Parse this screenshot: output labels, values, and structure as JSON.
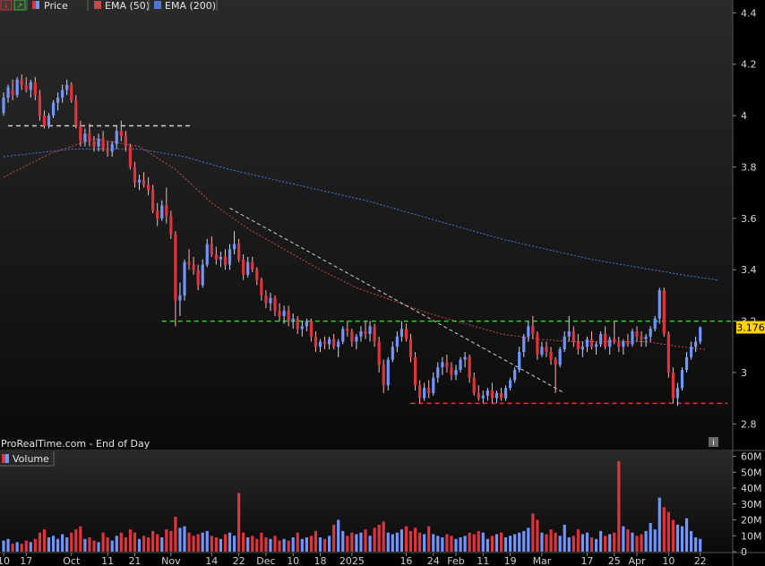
{
  "header": {
    "price_label": "Price",
    "ema50_label": "EMA (50)",
    "ema200_label": "EMA (200)"
  },
  "footer_text": "ProRealTime.com - End of Day",
  "volume_label": "Volume",
  "last_price_label": "3.176",
  "colors": {
    "up": "#6f95ff",
    "down": "#e0333a",
    "ema50": "#c84848",
    "ema200": "#4f76d6",
    "support": "#ff2a2a",
    "resistance": "#2ecc2e",
    "trend": "#cfcfcf",
    "price_tag": "#ffd400"
  },
  "chart_data": {
    "type": "candlestick",
    "price_axis": {
      "range": [
        2.7,
        4.45
      ],
      "ticks": [
        4.4,
        4.2,
        4,
        3.8,
        3.6,
        3.4,
        3.2,
        3,
        2.8
      ],
      "tick_labels": [
        "4.4",
        "4.2",
        "4",
        "3.8",
        "3.6",
        "3.4",
        "3.2",
        "3",
        "2.8"
      ]
    },
    "volume_axis": {
      "unit": "M",
      "range": [
        0,
        62
      ],
      "ticks": [
        60,
        50,
        40,
        30,
        20,
        10,
        0
      ],
      "tick_labels": [
        "60M",
        "50M",
        "40M",
        "30M",
        "20M",
        "10M",
        "0"
      ]
    },
    "x_labels": [
      {
        "label": "10",
        "i": 0
      },
      {
        "label": "17",
        "i": 5
      },
      {
        "label": "Oct",
        "i": 15
      },
      {
        "label": "11",
        "i": 23
      },
      {
        "label": "21",
        "i": 29
      },
      {
        "label": "Nov",
        "i": 37
      },
      {
        "label": "14",
        "i": 46
      },
      {
        "label": "22",
        "i": 52
      },
      {
        "label": "Dec",
        "i": 58
      },
      {
        "label": "10",
        "i": 64
      },
      {
        "label": "18",
        "i": 70
      },
      {
        "label": "2025",
        "i": 77
      },
      {
        "label": "16",
        "i": 89
      },
      {
        "label": "24",
        "i": 95
      },
      {
        "label": "Feb",
        "i": 100
      },
      {
        "label": "11",
        "i": 106
      },
      {
        "label": "19",
        "i": 112
      },
      {
        "label": "Mar",
        "i": 119
      },
      {
        "label": "17",
        "i": 129
      },
      {
        "label": "25",
        "i": 135
      },
      {
        "label": "Apr",
        "i": 140
      },
      {
        "label": "10",
        "i": 147
      },
      {
        "label": "22",
        "i": 154
      }
    ],
    "candles_ohlc_note": "open,high,low,close,volume(M)",
    "candles": [
      [
        4.01,
        4.09,
        4.0,
        4.07,
        7
      ],
      [
        4.07,
        4.12,
        4.05,
        4.11,
        8
      ],
      [
        4.1,
        4.14,
        4.06,
        4.08,
        5
      ],
      [
        4.08,
        4.15,
        4.07,
        4.14,
        6
      ],
      [
        4.14,
        4.16,
        4.1,
        4.12,
        5
      ],
      [
        4.12,
        4.15,
        4.09,
        4.1,
        7
      ],
      [
        4.1,
        4.14,
        4.07,
        4.13,
        6
      ],
      [
        4.13,
        4.15,
        4.06,
        4.08,
        8
      ],
      [
        4.08,
        4.1,
        3.98,
        4.0,
        12
      ],
      [
        4.0,
        4.02,
        3.95,
        3.96,
        14
      ],
      [
        3.96,
        4.01,
        3.95,
        4.0,
        9
      ],
      [
        4.0,
        4.06,
        3.99,
        4.05,
        10
      ],
      [
        4.05,
        4.09,
        4.02,
        4.07,
        8
      ],
      [
        4.07,
        4.12,
        4.05,
        4.1,
        11
      ],
      [
        4.1,
        4.14,
        4.08,
        4.12,
        9
      ],
      [
        4.12,
        4.13,
        4.05,
        4.06,
        12
      ],
      [
        4.06,
        4.08,
        3.95,
        3.96,
        14
      ],
      [
        3.96,
        3.98,
        3.88,
        3.9,
        16
      ],
      [
        3.9,
        3.95,
        3.88,
        3.93,
        8
      ],
      [
        3.93,
        3.97,
        3.88,
        3.9,
        9
      ],
      [
        3.9,
        3.92,
        3.86,
        3.88,
        7
      ],
      [
        3.88,
        3.93,
        3.86,
        3.91,
        6
      ],
      [
        3.91,
        3.94,
        3.86,
        3.87,
        12
      ],
      [
        3.87,
        3.9,
        3.84,
        3.86,
        9
      ],
      [
        3.86,
        3.9,
        3.84,
        3.89,
        7
      ],
      [
        3.89,
        3.96,
        3.87,
        3.94,
        10
      ],
      [
        3.94,
        3.98,
        3.9,
        3.92,
        12
      ],
      [
        3.92,
        3.94,
        3.86,
        3.88,
        9
      ],
      [
        3.88,
        3.89,
        3.79,
        3.8,
        14
      ],
      [
        3.8,
        3.82,
        3.72,
        3.74,
        12
      ],
      [
        3.74,
        3.77,
        3.71,
        3.75,
        8
      ],
      [
        3.75,
        3.78,
        3.72,
        3.73,
        10
      ],
      [
        3.73,
        3.76,
        3.69,
        3.71,
        9
      ],
      [
        3.71,
        3.73,
        3.62,
        3.63,
        13
      ],
      [
        3.63,
        3.66,
        3.57,
        3.6,
        11
      ],
      [
        3.6,
        3.67,
        3.59,
        3.65,
        9
      ],
      [
        3.65,
        3.72,
        3.58,
        3.61,
        14
      ],
      [
        3.61,
        3.63,
        3.52,
        3.54,
        13
      ],
      [
        3.54,
        3.55,
        3.18,
        3.28,
        22
      ],
      [
        3.28,
        3.35,
        3.22,
        3.3,
        15
      ],
      [
        3.3,
        3.44,
        3.28,
        3.43,
        16
      ],
      [
        3.43,
        3.48,
        3.4,
        3.42,
        12
      ],
      [
        3.42,
        3.45,
        3.38,
        3.4,
        10
      ],
      [
        3.4,
        3.42,
        3.32,
        3.34,
        11
      ],
      [
        3.34,
        3.44,
        3.33,
        3.42,
        12
      ],
      [
        3.42,
        3.52,
        3.41,
        3.5,
        13
      ],
      [
        3.5,
        3.53,
        3.45,
        3.46,
        10
      ],
      [
        3.46,
        3.49,
        3.42,
        3.44,
        9
      ],
      [
        3.44,
        3.47,
        3.41,
        3.45,
        8
      ],
      [
        3.45,
        3.48,
        3.4,
        3.42,
        11
      ],
      [
        3.42,
        3.5,
        3.4,
        3.48,
        12
      ],
      [
        3.48,
        3.55,
        3.46,
        3.5,
        10
      ],
      [
        3.5,
        3.52,
        3.43,
        3.44,
        37
      ],
      [
        3.44,
        3.46,
        3.36,
        3.38,
        12
      ],
      [
        3.38,
        3.45,
        3.37,
        3.43,
        9
      ],
      [
        3.43,
        3.45,
        3.39,
        3.4,
        10
      ],
      [
        3.4,
        3.41,
        3.34,
        3.36,
        8
      ],
      [
        3.36,
        3.37,
        3.28,
        3.3,
        12
      ],
      [
        3.3,
        3.32,
        3.25,
        3.27,
        9
      ],
      [
        3.27,
        3.31,
        3.24,
        3.29,
        8
      ],
      [
        3.29,
        3.3,
        3.22,
        3.24,
        10
      ],
      [
        3.24,
        3.27,
        3.2,
        3.22,
        7
      ],
      [
        3.22,
        3.26,
        3.19,
        3.24,
        8
      ],
      [
        3.24,
        3.26,
        3.18,
        3.2,
        7
      ],
      [
        3.2,
        3.23,
        3.17,
        3.21,
        9
      ],
      [
        3.21,
        3.22,
        3.15,
        3.17,
        12
      ],
      [
        3.17,
        3.2,
        3.14,
        3.18,
        8
      ],
      [
        3.18,
        3.21,
        3.16,
        3.2,
        9
      ],
      [
        3.2,
        3.21,
        3.12,
        3.14,
        10
      ],
      [
        3.14,
        3.16,
        3.08,
        3.1,
        13
      ],
      [
        3.1,
        3.13,
        3.08,
        3.12,
        9
      ],
      [
        3.12,
        3.14,
        3.09,
        3.11,
        8
      ],
      [
        3.11,
        3.14,
        3.09,
        3.13,
        10
      ],
      [
        3.13,
        3.15,
        3.09,
        3.1,
        17
      ],
      [
        3.1,
        3.13,
        3.06,
        3.12,
        20
      ],
      [
        3.12,
        3.18,
        3.11,
        3.17,
        13
      ],
      [
        3.17,
        3.2,
        3.14,
        3.16,
        10
      ],
      [
        3.16,
        3.17,
        3.1,
        3.12,
        12
      ],
      [
        3.12,
        3.15,
        3.09,
        3.14,
        11
      ],
      [
        3.14,
        3.18,
        3.12,
        3.16,
        12
      ],
      [
        3.16,
        3.2,
        3.13,
        3.15,
        14
      ],
      [
        3.15,
        3.2,
        3.12,
        3.18,
        10
      ],
      [
        3.18,
        3.19,
        3.1,
        3.12,
        15
      ],
      [
        3.12,
        3.14,
        3.0,
        3.03,
        17
      ],
      [
        3.03,
        3.05,
        2.92,
        2.95,
        19
      ],
      [
        2.95,
        3.06,
        2.93,
        3.05,
        12
      ],
      [
        3.05,
        3.12,
        3.04,
        3.1,
        11
      ],
      [
        3.1,
        3.16,
        3.08,
        3.14,
        12
      ],
      [
        3.14,
        3.2,
        3.12,
        3.17,
        14
      ],
      [
        3.17,
        3.19,
        3.12,
        3.13,
        16
      ],
      [
        3.13,
        3.15,
        3.04,
        3.06,
        13
      ],
      [
        3.06,
        3.08,
        2.93,
        2.95,
        15
      ],
      [
        2.95,
        2.97,
        2.88,
        2.9,
        12
      ],
      [
        2.9,
        2.96,
        2.89,
        2.94,
        11
      ],
      [
        2.94,
        2.97,
        2.9,
        2.92,
        16
      ],
      [
        2.92,
        3.0,
        2.91,
        2.98,
        11
      ],
      [
        2.98,
        3.04,
        2.96,
        3.02,
        10
      ],
      [
        3.02,
        3.06,
        2.99,
        3.04,
        9
      ],
      [
        3.04,
        3.07,
        3.0,
        3.02,
        11
      ],
      [
        3.02,
        3.04,
        2.97,
        2.99,
        10
      ],
      [
        2.99,
        3.03,
        2.97,
        3.01,
        8
      ],
      [
        3.01,
        3.06,
        3.0,
        3.05,
        9
      ],
      [
        3.05,
        3.08,
        3.02,
        3.06,
        10
      ],
      [
        3.06,
        3.07,
        2.96,
        2.98,
        12
      ],
      [
        2.98,
        3.0,
        2.91,
        2.92,
        11
      ],
      [
        2.92,
        2.95,
        2.89,
        2.9,
        13
      ],
      [
        2.9,
        2.93,
        2.88,
        2.91,
        12
      ],
      [
        2.91,
        2.94,
        2.89,
        2.93,
        8
      ],
      [
        2.93,
        2.96,
        2.88,
        2.9,
        10
      ],
      [
        2.9,
        2.93,
        2.88,
        2.92,
        11
      ],
      [
        2.92,
        2.94,
        2.89,
        2.9,
        12
      ],
      [
        2.9,
        2.95,
        2.89,
        2.94,
        9
      ],
      [
        2.94,
        2.98,
        2.93,
        2.97,
        10
      ],
      [
        2.97,
        3.02,
        2.96,
        3.01,
        11
      ],
      [
        3.01,
        3.1,
        3.0,
        3.08,
        12
      ],
      [
        3.08,
        3.15,
        3.06,
        3.14,
        13
      ],
      [
        3.14,
        3.2,
        3.12,
        3.18,
        15
      ],
      [
        3.18,
        3.22,
        3.13,
        3.15,
        24
      ],
      [
        3.15,
        3.16,
        3.05,
        3.07,
        20
      ],
      [
        3.07,
        3.12,
        3.06,
        3.1,
        12
      ],
      [
        3.1,
        3.12,
        3.06,
        3.08,
        11
      ],
      [
        3.08,
        3.1,
        3.03,
        3.05,
        14
      ],
      [
        3.05,
        3.06,
        2.92,
        3.03,
        12
      ],
      [
        3.03,
        3.1,
        3.02,
        3.09,
        10
      ],
      [
        3.09,
        3.16,
        3.08,
        3.14,
        17
      ],
      [
        3.14,
        3.22,
        3.12,
        3.16,
        9
      ],
      [
        3.16,
        3.18,
        3.1,
        3.12,
        10
      ],
      [
        3.12,
        3.15,
        3.07,
        3.09,
        14
      ],
      [
        3.09,
        3.12,
        3.06,
        3.1,
        11
      ],
      [
        3.1,
        3.14,
        3.08,
        3.13,
        12
      ],
      [
        3.13,
        3.16,
        3.09,
        3.1,
        9
      ],
      [
        3.1,
        3.12,
        3.07,
        3.11,
        8
      ],
      [
        3.11,
        3.16,
        3.1,
        3.15,
        13
      ],
      [
        3.15,
        3.18,
        3.09,
        3.1,
        10
      ],
      [
        3.1,
        3.14,
        3.07,
        3.13,
        11
      ],
      [
        3.13,
        3.2,
        3.11,
        3.12,
        12
      ],
      [
        3.12,
        3.14,
        3.08,
        3.1,
        57
      ],
      [
        3.1,
        3.13,
        3.07,
        3.12,
        16
      ],
      [
        3.12,
        3.15,
        3.1,
        3.11,
        14
      ],
      [
        3.11,
        3.17,
        3.1,
        3.16,
        12
      ],
      [
        3.16,
        3.18,
        3.12,
        3.14,
        10
      ],
      [
        3.14,
        3.16,
        3.1,
        3.13,
        11
      ],
      [
        3.13,
        3.15,
        3.1,
        3.14,
        13
      ],
      [
        3.14,
        3.18,
        3.12,
        3.17,
        18
      ],
      [
        3.17,
        3.22,
        3.16,
        3.21,
        14
      ],
      [
        3.21,
        3.33,
        3.19,
        3.32,
        34
      ],
      [
        3.32,
        3.33,
        3.14,
        3.15,
        28
      ],
      [
        3.15,
        3.16,
        2.98,
        3.0,
        25
      ],
      [
        3.0,
        3.02,
        2.88,
        2.9,
        20
      ],
      [
        2.9,
        2.96,
        2.87,
        2.94,
        17
      ],
      [
        2.94,
        3.02,
        2.93,
        3.01,
        16
      ],
      [
        3.01,
        3.08,
        3.0,
        3.06,
        21
      ],
      [
        3.06,
        3.12,
        3.05,
        3.1,
        13
      ],
      [
        3.1,
        3.14,
        3.08,
        3.12,
        9
      ],
      [
        3.12,
        3.18,
        3.11,
        3.176,
        8
      ]
    ],
    "ema50_points": [
      [
        0,
        3.76
      ],
      [
        10,
        3.85
      ],
      [
        20,
        3.91
      ],
      [
        30,
        3.88
      ],
      [
        38,
        3.79
      ],
      [
        46,
        3.66
      ],
      [
        54,
        3.56
      ],
      [
        62,
        3.48
      ],
      [
        70,
        3.4
      ],
      [
        78,
        3.33
      ],
      [
        86,
        3.28
      ],
      [
        94,
        3.23
      ],
      [
        102,
        3.19
      ],
      [
        110,
        3.15
      ],
      [
        118,
        3.13
      ],
      [
        126,
        3.12
      ],
      [
        134,
        3.12
      ],
      [
        142,
        3.12
      ],
      [
        150,
        3.1
      ],
      [
        155,
        3.09
      ]
    ],
    "ema200_points": [
      [
        0,
        3.84
      ],
      [
        15,
        3.87
      ],
      [
        30,
        3.87
      ],
      [
        40,
        3.84
      ],
      [
        50,
        3.79
      ],
      [
        60,
        3.75
      ],
      [
        70,
        3.71
      ],
      [
        80,
        3.67
      ],
      [
        90,
        3.62
      ],
      [
        100,
        3.57
      ],
      [
        110,
        3.52
      ],
      [
        120,
        3.48
      ],
      [
        130,
        3.44
      ],
      [
        140,
        3.41
      ],
      [
        150,
        3.38
      ],
      [
        158,
        3.36
      ]
    ],
    "annotations": [
      {
        "kind": "hline",
        "style": "dashed",
        "color_key": "trend",
        "i0": 1,
        "i1": 42,
        "y": 3.96
      },
      {
        "kind": "hline",
        "style": "dashed",
        "color_key": "resistance",
        "i0": 35,
        "i1": 162,
        "y": 3.2
      },
      {
        "kind": "hline",
        "style": "dashed",
        "color_key": "support",
        "i0": 90,
        "i1": 160,
        "y": 2.88
      },
      {
        "kind": "segment",
        "style": "dashed",
        "color_key": "trend",
        "i0": 50,
        "y0": 3.64,
        "i1": 124,
        "y1": 2.92
      }
    ]
  }
}
